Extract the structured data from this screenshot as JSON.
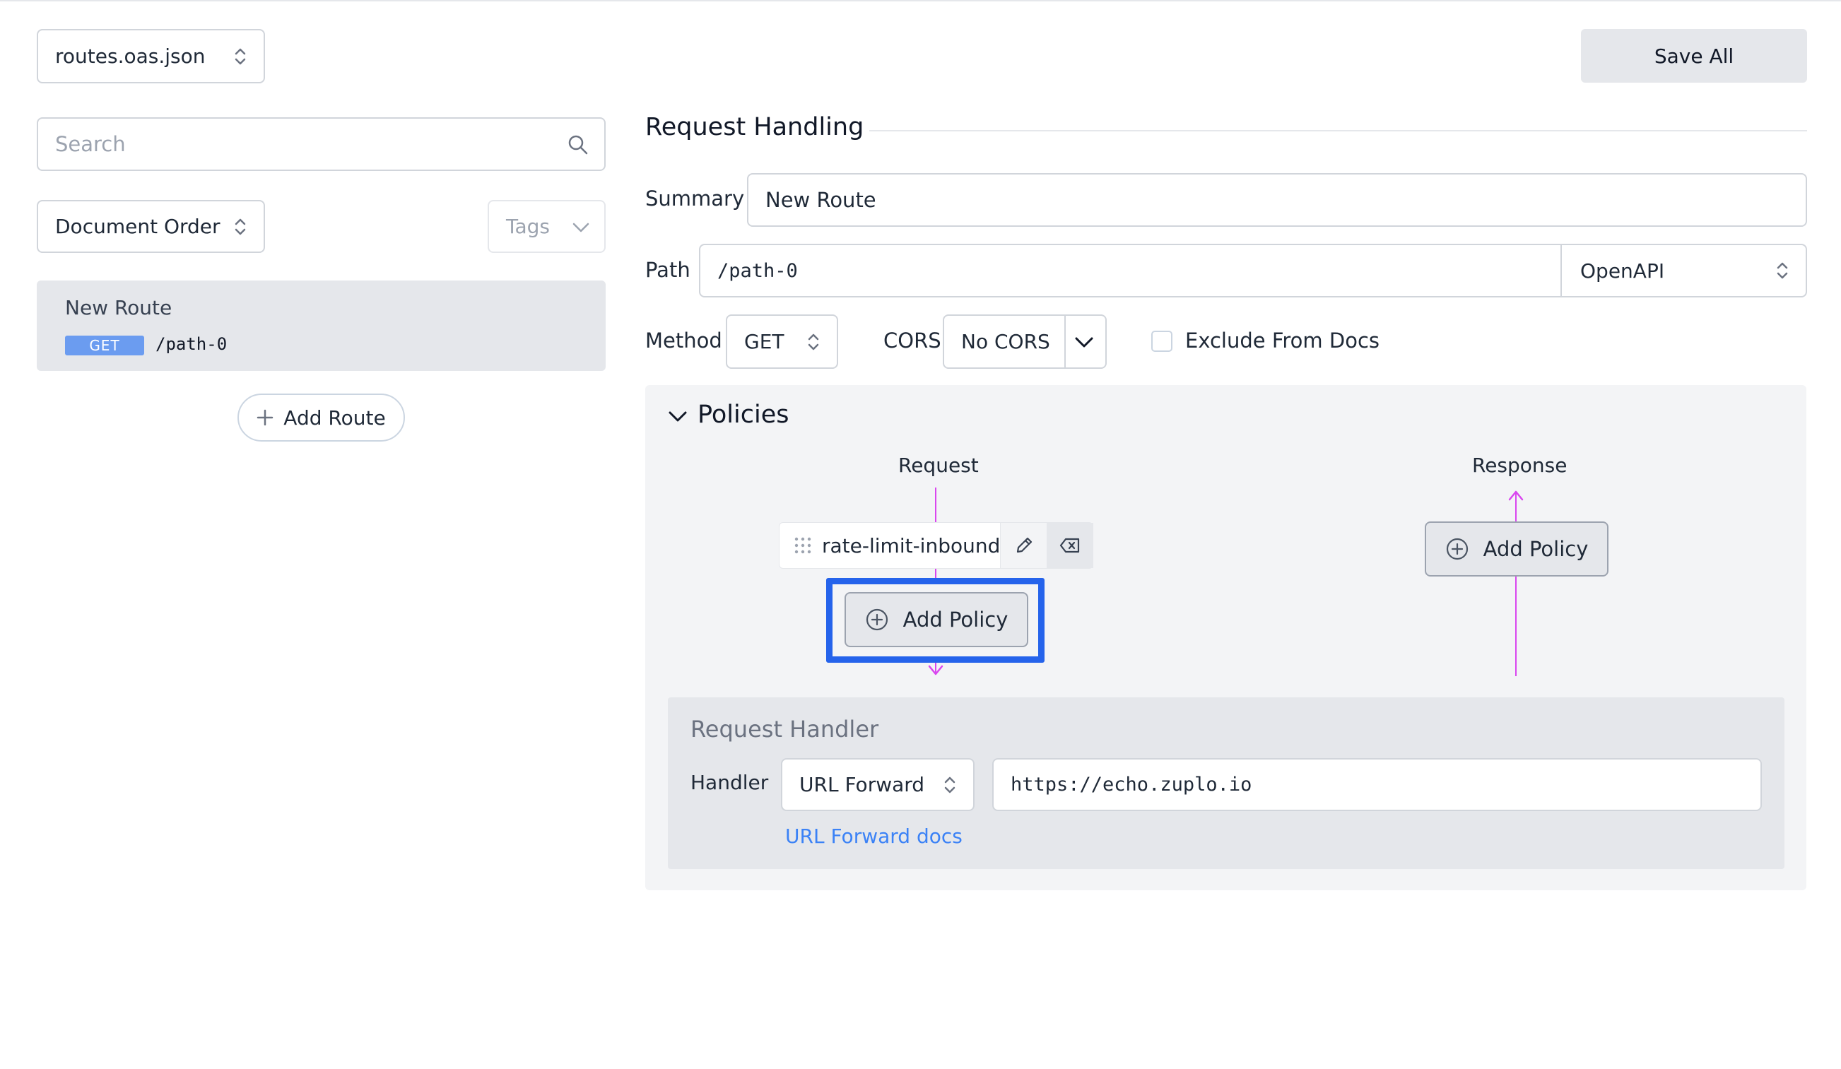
{
  "file_selector": {
    "value": "routes.oas.json"
  },
  "toolbar": {
    "save_all_label": "Save All"
  },
  "sidebar": {
    "search": {
      "placeholder": "Search"
    },
    "sort": {
      "value": "Document Order"
    },
    "tags": {
      "placeholder": "Tags"
    },
    "routes": [
      {
        "name": "New Route",
        "method": "GET",
        "path": "/path-0"
      }
    ],
    "add_route_label": "Add Route"
  },
  "main": {
    "section_title": "Request Handling",
    "summary": {
      "label": "Summary",
      "value": "New Route"
    },
    "path": {
      "label": "Path",
      "value": "/path-0",
      "mode": "OpenAPI"
    },
    "method": {
      "label": "Method",
      "value": "GET"
    },
    "cors": {
      "label": "CORS",
      "value": "No CORS"
    },
    "exclude_from_docs": {
      "label": "Exclude From Docs",
      "checked": false
    },
    "policies": {
      "title": "Policies",
      "request_label": "Request",
      "response_label": "Response",
      "request_policies": [
        "rate-limit-inbound"
      ],
      "add_policy_label": "Add Policy",
      "line_color": "#d946ef",
      "highlight_color": "#2563eb"
    },
    "handler": {
      "title": "Request Handler",
      "label": "Handler",
      "type": "URL Forward",
      "url": "https://echo.zuplo.io",
      "docs_link": "URL Forward docs",
      "link_color": "#3b82f6"
    }
  }
}
